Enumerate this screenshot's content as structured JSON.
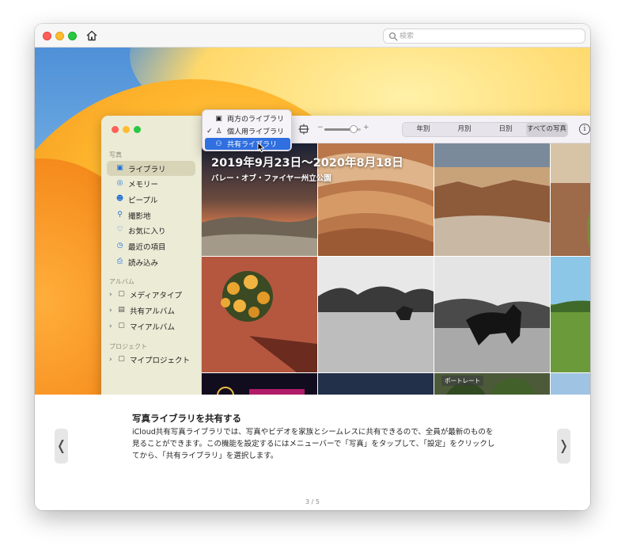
{
  "titlebar": {
    "search_placeholder": "検索"
  },
  "photos_app": {
    "sidebar": {
      "section_photos": "写真",
      "items": [
        {
          "label": "ライブラリ",
          "icon": "photo-library-icon",
          "selected": true
        },
        {
          "label": "メモリー",
          "icon": "memories-icon",
          "selected": false
        },
        {
          "label": "ピープル",
          "icon": "people-icon",
          "selected": false
        },
        {
          "label": "撮影地",
          "icon": "places-icon",
          "selected": false
        },
        {
          "label": "お気に入り",
          "icon": "heart-icon",
          "selected": false
        },
        {
          "label": "最近の項目",
          "icon": "clock-icon",
          "selected": false
        },
        {
          "label": "読み込み",
          "icon": "import-icon",
          "selected": false
        }
      ],
      "section_albums": "アルバム",
      "album_items": [
        {
          "label": "メディアタイプ",
          "icon": "folder-icon"
        },
        {
          "label": "共有アルバム",
          "icon": "shared-album-icon"
        },
        {
          "label": "マイアルバム",
          "icon": "folder-icon"
        }
      ],
      "section_projects": "プロジェクト",
      "project_items": [
        {
          "label": "マイプロジェクト",
          "icon": "folder-icon"
        }
      ]
    },
    "toolbar": {
      "zoom_level": 0.8,
      "segments": [
        "年別",
        "月別",
        "日別",
        "すべての写真"
      ],
      "selected_segment": "すべての写真"
    },
    "library_menu": {
      "items": [
        {
          "label": "両方のライブラリ",
          "icon": "both-libraries-icon",
          "checked": false,
          "highlighted": false
        },
        {
          "label": "個人用ライブラリ",
          "icon": "person-icon",
          "checked": true,
          "highlighted": false
        },
        {
          "label": "共有ライブラリ",
          "icon": "shared-people-icon",
          "checked": false,
          "highlighted": true
        }
      ]
    },
    "grid": {
      "header_title": "2019年9月23日〜2020年8月18日",
      "header_subtitle": "バレー・オブ・ファイヤー州立公園",
      "portrait_badge": "ポートレート"
    }
  },
  "info_panel": {
    "title": "写真ライブラリを共有する",
    "body": "iCloud共有写真ライブラリでは、写真やビデオを家族とシームレスに共有できるので、全員が最新のものを見ることができます。この機能を設定するにはメニューバーで「写真」をタップして、「設定」をクリックしてから、「共有ライブラリ」を選択します。",
    "page_indicator": "3 / 5",
    "prev_glyph": "❬",
    "next_glyph": "❭"
  }
}
